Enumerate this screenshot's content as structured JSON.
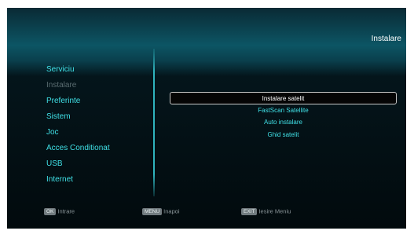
{
  "header": {
    "title": "Instalare"
  },
  "sidebar": {
    "items": [
      {
        "label": "Serviciu"
      },
      {
        "label": "Instalare"
      },
      {
        "label": "Preferinte"
      },
      {
        "label": "Sistem"
      },
      {
        "label": "Joc"
      },
      {
        "label": "Acces Conditionat"
      },
      {
        "label": "USB"
      },
      {
        "label": "Internet"
      }
    ],
    "active": "Instalare"
  },
  "submenu": {
    "items": [
      {
        "label": "Instalare satelit"
      },
      {
        "label": "FastScan Satellite"
      },
      {
        "label": "Auto instalare"
      },
      {
        "label": "Ghid satelit"
      }
    ],
    "selected": "Instalare satelit"
  },
  "footer": {
    "ok_key": "OK",
    "ok_label": "Intrare",
    "menu_key": "MENU",
    "menu_label": "Inapoi",
    "exit_key": "EXIT",
    "exit_label": "Iesire Meniu"
  },
  "colors": {
    "accent": "#40e0e6",
    "header_band": "#0c5564",
    "background": "#020a0d",
    "dim_text": "#5a6c70"
  }
}
